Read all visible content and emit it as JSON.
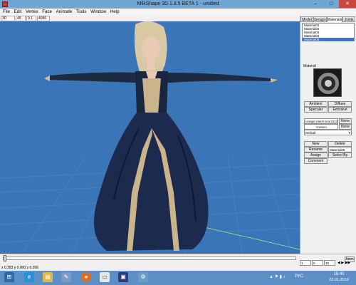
{
  "window": {
    "title": "MilkShape 3D 1.8.5 BETA 1 - untitled",
    "min": "–",
    "max": "□",
    "close": "✕"
  },
  "menu": [
    "File",
    "Edit",
    "Vertex",
    "Face",
    "Animate",
    "Tools",
    "Window",
    "Help"
  ],
  "toolbar": {
    "view": "3D",
    "v1": "45",
    "v2": "0.1",
    "v3": "4096"
  },
  "panel": {
    "tabs": [
      "Model",
      "Groups",
      "Materials",
      "Joints"
    ],
    "active_tab": "Materials",
    "materials": [
      "Material01",
      "Material02",
      "Material03",
      "Material04",
      "Material05"
    ],
    "selected_material": "Material05",
    "material_label": "Material",
    "ambient": "Ambient",
    "diffuse": "Diffuse",
    "specular": "Specular",
    "emissive": "Emissive",
    "texture1": "сmaре.nnet+сnоn:512.p",
    "texture1_btn": "None",
    "texture2": "<none>",
    "texture2_btn": "None",
    "mode": "Default",
    "new": "New",
    "delete": "Delete",
    "rename": "Rename",
    "rename_value": "Material05",
    "assign": "Assign",
    "select_by": "Select By",
    "comment": "Comment"
  },
  "timeline": {
    "anim_btn": "Anim",
    "frame_start": "1",
    "frame_end": "30",
    "frame_cur": "0",
    "ticks": [
      "0",
      "3",
      "1"
    ]
  },
  "status": {
    "coords": "x 0.383 y 0.000 z 0.266"
  },
  "taskbar": {
    "icons": [
      "start-icon",
      "ie-icon",
      "explorer-icon",
      "paint-icon",
      "firefox-icon",
      "notepad-icon",
      "milkshape-icon",
      "tool-icon"
    ],
    "lang": "РУС",
    "time": "15:40",
    "date": "22.01.2019"
  },
  "colors": {
    "viewport": "#3a76b7",
    "accent": "#3176d6",
    "taskbar": "#5d8fc7"
  }
}
